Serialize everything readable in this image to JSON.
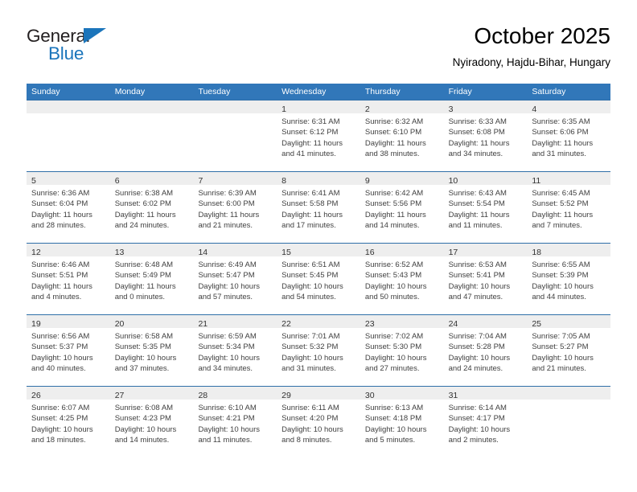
{
  "brand": {
    "name_top": "General",
    "name_bottom": "Blue",
    "triangle_color": "#1b75bb",
    "text_color_top": "#231f20",
    "text_color_bottom": "#1b75bb"
  },
  "header": {
    "title": "October 2025",
    "subtitle": "Nyiradony, Hajdu-Bihar, Hungary"
  },
  "colors": {
    "header_blue": "#3177b9",
    "row_divider": "#2f6fa8",
    "day_band": "#eeeeee",
    "body_text": "#404040"
  },
  "weekdays": [
    "Sunday",
    "Monday",
    "Tuesday",
    "Wednesday",
    "Thursday",
    "Friday",
    "Saturday"
  ],
  "weeks": [
    [
      {
        "day": "",
        "sunrise": "",
        "sunset": "",
        "daylight_line1": "",
        "daylight_line2": ""
      },
      {
        "day": "",
        "sunrise": "",
        "sunset": "",
        "daylight_line1": "",
        "daylight_line2": ""
      },
      {
        "day": "",
        "sunrise": "",
        "sunset": "",
        "daylight_line1": "",
        "daylight_line2": ""
      },
      {
        "day": "1",
        "sunrise": "Sunrise: 6:31 AM",
        "sunset": "Sunset: 6:12 PM",
        "daylight_line1": "Daylight: 11 hours",
        "daylight_line2": "and 41 minutes."
      },
      {
        "day": "2",
        "sunrise": "Sunrise: 6:32 AM",
        "sunset": "Sunset: 6:10 PM",
        "daylight_line1": "Daylight: 11 hours",
        "daylight_line2": "and 38 minutes."
      },
      {
        "day": "3",
        "sunrise": "Sunrise: 6:33 AM",
        "sunset": "Sunset: 6:08 PM",
        "daylight_line1": "Daylight: 11 hours",
        "daylight_line2": "and 34 minutes."
      },
      {
        "day": "4",
        "sunrise": "Sunrise: 6:35 AM",
        "sunset": "Sunset: 6:06 PM",
        "daylight_line1": "Daylight: 11 hours",
        "daylight_line2": "and 31 minutes."
      }
    ],
    [
      {
        "day": "5",
        "sunrise": "Sunrise: 6:36 AM",
        "sunset": "Sunset: 6:04 PM",
        "daylight_line1": "Daylight: 11 hours",
        "daylight_line2": "and 28 minutes."
      },
      {
        "day": "6",
        "sunrise": "Sunrise: 6:38 AM",
        "sunset": "Sunset: 6:02 PM",
        "daylight_line1": "Daylight: 11 hours",
        "daylight_line2": "and 24 minutes."
      },
      {
        "day": "7",
        "sunrise": "Sunrise: 6:39 AM",
        "sunset": "Sunset: 6:00 PM",
        "daylight_line1": "Daylight: 11 hours",
        "daylight_line2": "and 21 minutes."
      },
      {
        "day": "8",
        "sunrise": "Sunrise: 6:41 AM",
        "sunset": "Sunset: 5:58 PM",
        "daylight_line1": "Daylight: 11 hours",
        "daylight_line2": "and 17 minutes."
      },
      {
        "day": "9",
        "sunrise": "Sunrise: 6:42 AM",
        "sunset": "Sunset: 5:56 PM",
        "daylight_line1": "Daylight: 11 hours",
        "daylight_line2": "and 14 minutes."
      },
      {
        "day": "10",
        "sunrise": "Sunrise: 6:43 AM",
        "sunset": "Sunset: 5:54 PM",
        "daylight_line1": "Daylight: 11 hours",
        "daylight_line2": "and 11 minutes."
      },
      {
        "day": "11",
        "sunrise": "Sunrise: 6:45 AM",
        "sunset": "Sunset: 5:52 PM",
        "daylight_line1": "Daylight: 11 hours",
        "daylight_line2": "and 7 minutes."
      }
    ],
    [
      {
        "day": "12",
        "sunrise": "Sunrise: 6:46 AM",
        "sunset": "Sunset: 5:51 PM",
        "daylight_line1": "Daylight: 11 hours",
        "daylight_line2": "and 4 minutes."
      },
      {
        "day": "13",
        "sunrise": "Sunrise: 6:48 AM",
        "sunset": "Sunset: 5:49 PM",
        "daylight_line1": "Daylight: 11 hours",
        "daylight_line2": "and 0 minutes."
      },
      {
        "day": "14",
        "sunrise": "Sunrise: 6:49 AM",
        "sunset": "Sunset: 5:47 PM",
        "daylight_line1": "Daylight: 10 hours",
        "daylight_line2": "and 57 minutes."
      },
      {
        "day": "15",
        "sunrise": "Sunrise: 6:51 AM",
        "sunset": "Sunset: 5:45 PM",
        "daylight_line1": "Daylight: 10 hours",
        "daylight_line2": "and 54 minutes."
      },
      {
        "day": "16",
        "sunrise": "Sunrise: 6:52 AM",
        "sunset": "Sunset: 5:43 PM",
        "daylight_line1": "Daylight: 10 hours",
        "daylight_line2": "and 50 minutes."
      },
      {
        "day": "17",
        "sunrise": "Sunrise: 6:53 AM",
        "sunset": "Sunset: 5:41 PM",
        "daylight_line1": "Daylight: 10 hours",
        "daylight_line2": "and 47 minutes."
      },
      {
        "day": "18",
        "sunrise": "Sunrise: 6:55 AM",
        "sunset": "Sunset: 5:39 PM",
        "daylight_line1": "Daylight: 10 hours",
        "daylight_line2": "and 44 minutes."
      }
    ],
    [
      {
        "day": "19",
        "sunrise": "Sunrise: 6:56 AM",
        "sunset": "Sunset: 5:37 PM",
        "daylight_line1": "Daylight: 10 hours",
        "daylight_line2": "and 40 minutes."
      },
      {
        "day": "20",
        "sunrise": "Sunrise: 6:58 AM",
        "sunset": "Sunset: 5:35 PM",
        "daylight_line1": "Daylight: 10 hours",
        "daylight_line2": "and 37 minutes."
      },
      {
        "day": "21",
        "sunrise": "Sunrise: 6:59 AM",
        "sunset": "Sunset: 5:34 PM",
        "daylight_line1": "Daylight: 10 hours",
        "daylight_line2": "and 34 minutes."
      },
      {
        "day": "22",
        "sunrise": "Sunrise: 7:01 AM",
        "sunset": "Sunset: 5:32 PM",
        "daylight_line1": "Daylight: 10 hours",
        "daylight_line2": "and 31 minutes."
      },
      {
        "day": "23",
        "sunrise": "Sunrise: 7:02 AM",
        "sunset": "Sunset: 5:30 PM",
        "daylight_line1": "Daylight: 10 hours",
        "daylight_line2": "and 27 minutes."
      },
      {
        "day": "24",
        "sunrise": "Sunrise: 7:04 AM",
        "sunset": "Sunset: 5:28 PM",
        "daylight_line1": "Daylight: 10 hours",
        "daylight_line2": "and 24 minutes."
      },
      {
        "day": "25",
        "sunrise": "Sunrise: 7:05 AM",
        "sunset": "Sunset: 5:27 PM",
        "daylight_line1": "Daylight: 10 hours",
        "daylight_line2": "and 21 minutes."
      }
    ],
    [
      {
        "day": "26",
        "sunrise": "Sunrise: 6:07 AM",
        "sunset": "Sunset: 4:25 PM",
        "daylight_line1": "Daylight: 10 hours",
        "daylight_line2": "and 18 minutes."
      },
      {
        "day": "27",
        "sunrise": "Sunrise: 6:08 AM",
        "sunset": "Sunset: 4:23 PM",
        "daylight_line1": "Daylight: 10 hours",
        "daylight_line2": "and 14 minutes."
      },
      {
        "day": "28",
        "sunrise": "Sunrise: 6:10 AM",
        "sunset": "Sunset: 4:21 PM",
        "daylight_line1": "Daylight: 10 hours",
        "daylight_line2": "and 11 minutes."
      },
      {
        "day": "29",
        "sunrise": "Sunrise: 6:11 AM",
        "sunset": "Sunset: 4:20 PM",
        "daylight_line1": "Daylight: 10 hours",
        "daylight_line2": "and 8 minutes."
      },
      {
        "day": "30",
        "sunrise": "Sunrise: 6:13 AM",
        "sunset": "Sunset: 4:18 PM",
        "daylight_line1": "Daylight: 10 hours",
        "daylight_line2": "and 5 minutes."
      },
      {
        "day": "31",
        "sunrise": "Sunrise: 6:14 AM",
        "sunset": "Sunset: 4:17 PM",
        "daylight_line1": "Daylight: 10 hours",
        "daylight_line2": "and 2 minutes."
      },
      {
        "day": "",
        "sunrise": "",
        "sunset": "",
        "daylight_line1": "",
        "daylight_line2": ""
      }
    ]
  ]
}
